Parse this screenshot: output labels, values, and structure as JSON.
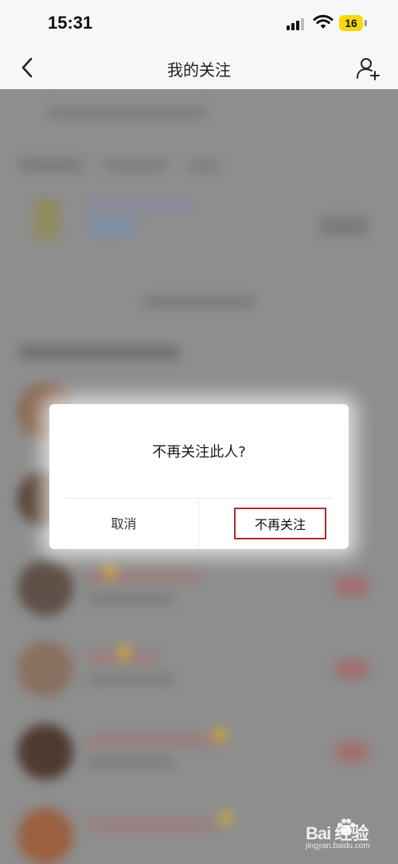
{
  "status_bar": {
    "time": "15:31",
    "battery_level": "16",
    "icons": [
      "signal-icon",
      "wifi-icon",
      "battery-icon"
    ]
  },
  "nav": {
    "title": "我的关注",
    "back_icon": "chevron-left-icon",
    "add_user_icon": "add-user-icon"
  },
  "dialog": {
    "message": "不再关注此人?",
    "cancel_label": "取消",
    "confirm_label": "不再关注"
  },
  "watermark": {
    "main": "Bai 经验",
    "sub": "jingyan.baidu.com"
  },
  "colors": {
    "highlight_border": "#b02a2a",
    "battery": "#f5d90a",
    "overlay": "#8e8e8e"
  }
}
